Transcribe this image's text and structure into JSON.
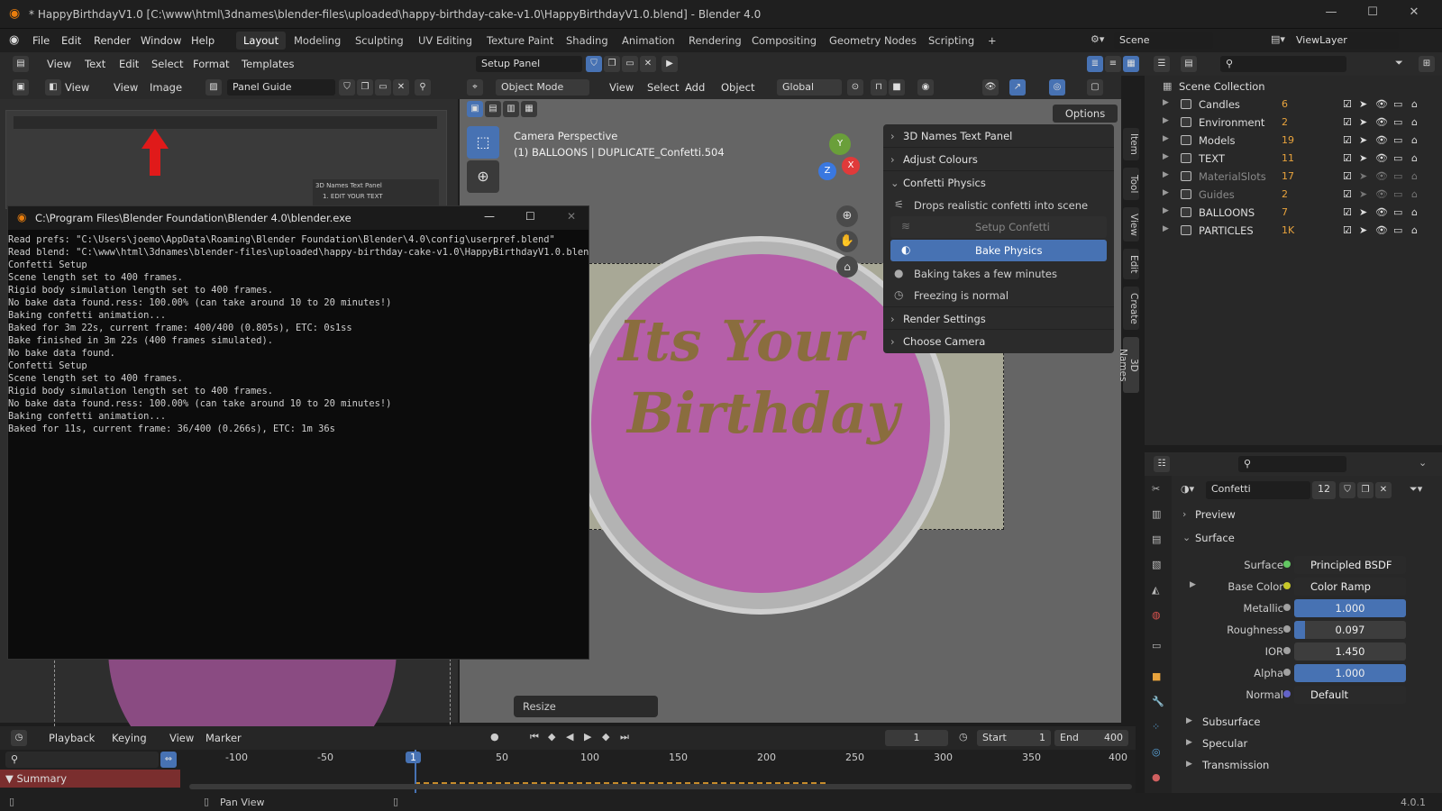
{
  "window": {
    "title": "* HappyBirthdayV1.0 [C:\\www\\html\\3dnames\\blender-files\\uploaded\\happy-birthday-cake-v1.0\\HappyBirthdayV1.0.blend] - Blender 4.0",
    "min": "—",
    "max": "☐",
    "close": "✕"
  },
  "menu": {
    "items": [
      "File",
      "Edit",
      "Render",
      "Window",
      "Help"
    ],
    "workspaces": [
      "Layout",
      "Modeling",
      "Sculpting",
      "UV Editing",
      "Texture Paint",
      "Shading",
      "Animation",
      "Rendering",
      "Compositing",
      "Geometry Nodes",
      "Scripting"
    ],
    "add_workspace": "+",
    "scene_label": "Scene",
    "viewlayer_label": "ViewLayer"
  },
  "text_editor_header": {
    "items": [
      "View",
      "Text",
      "Edit",
      "Select",
      "Format",
      "Templates"
    ],
    "panel_name": "Setup Panel"
  },
  "image_editor_header": {
    "view": "View",
    "items": [
      "View",
      "Image"
    ],
    "image_name": "Panel Guide"
  },
  "viewport_header": {
    "mode": "Object Mode",
    "items": [
      "View",
      "Select",
      "Add",
      "Object"
    ],
    "orientation": "Global",
    "options": "Options"
  },
  "viewport": {
    "camera_label": "Camera Perspective",
    "object_label": "(1) BALLOONS | DUPLICATE_Confetti.504",
    "cake_text_1": "Its Your",
    "cake_text_2": "Birthday",
    "axes": {
      "x": "X",
      "y": "Y",
      "z": "Z"
    },
    "resize": "Resize"
  },
  "npanel": {
    "sections": [
      "3D Names Text Panel",
      "Adjust Colours",
      "Confetti Physics"
    ],
    "confetti_items": [
      "Drops realistic confetti into scene",
      "Setup Confetti",
      "Bake Physics",
      "Baking takes a few minutes",
      "Freezing is normal"
    ],
    "sections_after": [
      "Render Settings",
      "Choose Camera"
    ],
    "side_tabs": [
      "Item",
      "Tool",
      "View",
      "Edit",
      "Create",
      "3D Names"
    ]
  },
  "console": {
    "title": "C:\\Program Files\\Blender Foundation\\Blender 4.0\\blender.exe",
    "lines": [
      "Read prefs: \"C:\\Users\\joemo\\AppData\\Roaming\\Blender Foundation\\Blender\\4.0\\config\\userpref.blend\"",
      "Read blend: \"C:\\www\\html\\3dnames\\blender-files\\uploaded\\happy-birthday-cake-v1.0\\HappyBirthdayV1.0.blend\"",
      "Confetti Setup",
      "Scene length set to 400 frames.",
      "Rigid body simulation length set to 400 frames.",
      "No bake data found.ress: 100.00% (can take around 10 to 20 minutes!)",
      "Baking confetti animation...",
      "Baked for 3m 22s, current frame: 400/400 (0.805s), ETC: 0s1ss",
      "Bake finished in 3m 22s (400 frames simulated).",
      "No bake data found.",
      "Confetti Setup",
      "Scene length set to 400 frames.",
      "Rigid body simulation length set to 400 frames.",
      "No bake data found.ress: 100.00% (can take around 10 to 20 minutes!)",
      "Baking confetti animation...",
      "Baked for 11s, current frame: 36/400 (0.266s), ETC: 1m 36s"
    ]
  },
  "guide_image": {
    "panel_label": "3D Names Text Panel",
    "panel_item": "1. EDIT YOUR TEXT"
  },
  "outliner": {
    "root": "Scene Collection",
    "collections": [
      {
        "name": "Candles",
        "badge": "6",
        "dim": false
      },
      {
        "name": "Environment",
        "badge": "2",
        "dim": false
      },
      {
        "name": "Models",
        "badge": "19",
        "dim": false
      },
      {
        "name": "TEXT",
        "badge": "11",
        "dim": false
      },
      {
        "name": "MaterialSlots",
        "badge": "17",
        "dim": true
      },
      {
        "name": "Guides",
        "badge": "2",
        "dim": true
      },
      {
        "name": "BALLOONS",
        "badge": "7",
        "dim": false
      },
      {
        "name": "PARTICLES",
        "badge": "1K",
        "dim": false
      }
    ]
  },
  "properties": {
    "material_name": "Confetti",
    "users": "12",
    "sections": [
      "Preview",
      "Surface"
    ],
    "surface_label": "Surface",
    "surface_value": "Principled BSDF",
    "base_color_label": "Base Color",
    "base_color_value": "Color Ramp",
    "metallic_label": "Metallic",
    "metallic": "1.000",
    "roughness_label": "Roughness",
    "roughness": "0.097",
    "ior_label": "IOR",
    "ior": "1.450",
    "alpha_label": "Alpha",
    "alpha": "1.000",
    "normal_label": "Normal",
    "normal": "Default",
    "subsections": [
      "Subsurface",
      "Specular",
      "Transmission"
    ]
  },
  "timeline": {
    "menus": [
      "Playback",
      "Keying",
      "View",
      "Marker"
    ],
    "current_frame": "1",
    "start_label": "Start",
    "start": "1",
    "end_label": "End",
    "end": "400",
    "ticks": [
      "-100",
      "-50",
      "1",
      "50",
      "100",
      "150",
      "200",
      "250",
      "300",
      "350",
      "400"
    ],
    "summary": "Summary"
  },
  "statusbar": {
    "pan": "Pan View",
    "version": "4.0.1"
  },
  "colors": {
    "accent_blue": "#4772b3",
    "cake_pink": "#b55fa8",
    "cake_text": "#8a6d3e"
  }
}
